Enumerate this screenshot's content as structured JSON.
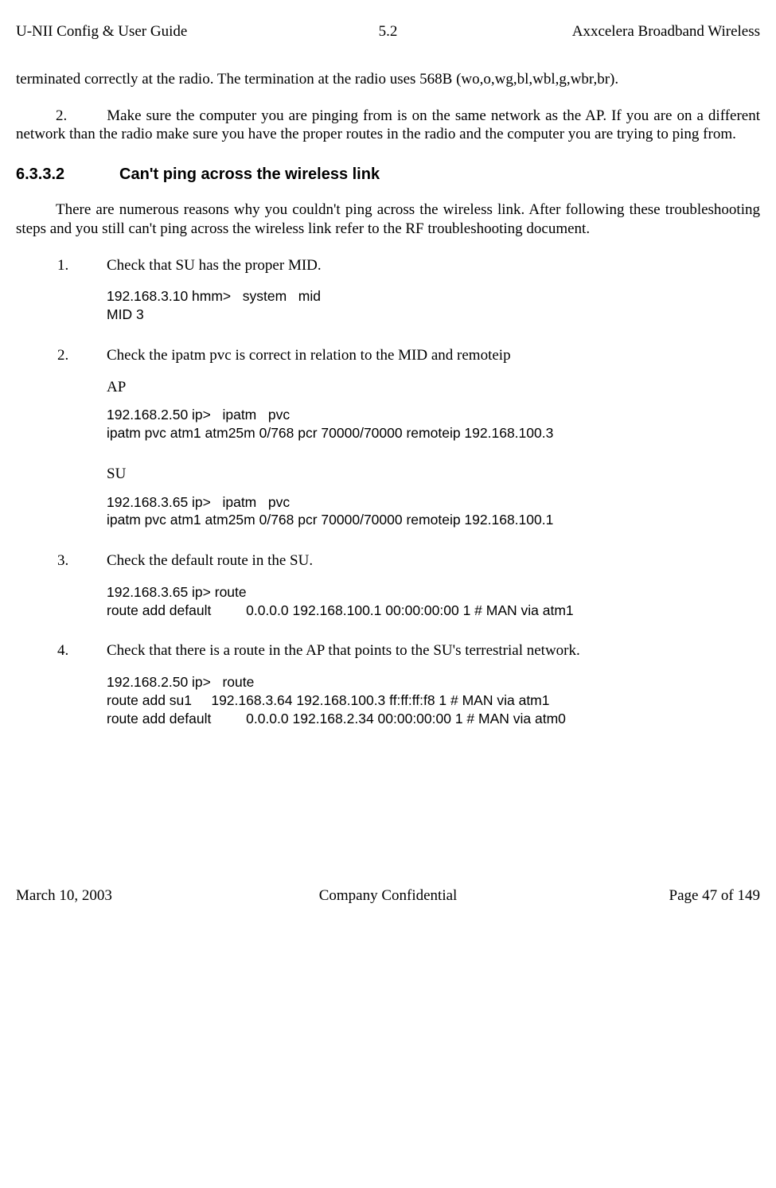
{
  "header": {
    "left": "U-NII Config & User Guide",
    "center": "5.2",
    "right": "Axxcelera Broadband Wireless"
  },
  "footer": {
    "left": "March 10, 2003",
    "center": "Company Confidential",
    "right": "Page 47 of 149"
  },
  "intro_paragraph": "terminated correctly at the radio. The termination at the radio uses 568B (wo,o,wg,bl,wbl,g,wbr,br).",
  "prev_step2_num": "2.",
  "prev_step2_text": "Make sure the computer you are pinging from is on the same network as the AP. If you are on a different network than the radio make sure you have the proper routes in the radio and the computer you are trying to ping from.",
  "section": {
    "number": "6.3.3.2",
    "title": "Can't ping across the wireless link"
  },
  "section_intro": "There are numerous reasons why you couldn't ping across the wireless link. After following these troubleshooting steps and you still can't ping across the wireless link refer to the RF troubleshooting document.",
  "steps": {
    "s1_num": "1.",
    "s1_text": "Check that SU has the proper MID.",
    "s1_code": "192.168.3.10 hmm>   system   mid\nMID 3",
    "s2_num": "2.",
    "s2_text": "Check the ipatm pvc is correct in relation to the MID and remoteip",
    "s2_ap_label": "AP",
    "s2_ap_code": "192.168.2.50 ip>   ipatm   pvc\nipatm pvc atm1 atm25m 0/768 pcr 70000/70000 remoteip 192.168.100.3",
    "s2_su_label": "SU",
    "s2_su_code": "192.168.3.65 ip>   ipatm   pvc\nipatm pvc atm1 atm25m 0/768 pcr 70000/70000 remoteip 192.168.100.1",
    "s3_num": "3.",
    "s3_text": "Check the default route in the SU.",
    "s3_code": "192.168.3.65 ip> route\nroute add default         0.0.0.0 192.168.100.1 00:00:00:00 1 # MAN via atm1",
    "s4_num": "4.",
    "s4_text": "Check that there is a route in the AP that points to the SU's terrestrial network.",
    "s4_code": "192.168.2.50 ip>   route\nroute add su1     192.168.3.64 192.168.100.3 ff:ff:ff:f8 1 # MAN via atm1\nroute add default         0.0.0.0 192.168.2.34 00:00:00:00 1 # MAN via atm0"
  }
}
